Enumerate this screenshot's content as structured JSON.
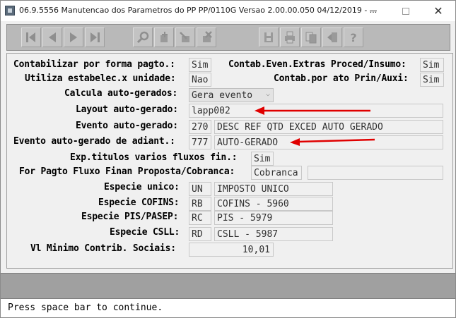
{
  "window": {
    "title": "06.9.5556 Manutencao dos  Parametros do PP PP/0110G Versao 2.00.00.050 04/12/2019 - ..."
  },
  "toolbar": {
    "buttons": [
      {
        "name": "first-record-icon"
      },
      {
        "name": "previous-record-icon"
      },
      {
        "name": "next-record-icon"
      },
      {
        "name": "last-record-icon"
      },
      {
        "name": "search-icon"
      },
      {
        "name": "add-icon"
      },
      {
        "name": "edit-icon"
      },
      {
        "name": "delete-icon"
      },
      {
        "name": "save-icon"
      },
      {
        "name": "print-icon"
      },
      {
        "name": "copy-icon"
      },
      {
        "name": "exit-icon"
      },
      {
        "name": "help-icon"
      }
    ]
  },
  "form": {
    "contabilizar_label": "Contabilizar por forma pagto.:",
    "contabilizar_value": "Sim",
    "contab_even_label": "Contab.Even.Extras Proced/Insumo:",
    "contab_even_value": "Sim",
    "utiliza_label": "Utiliza estabelec.x unidade:",
    "utiliza_value": "Nao",
    "contab_ato_label": "Contab.por ato Prin/Auxi:",
    "contab_ato_value": "Sim",
    "calcula_label": "Calcula auto-gerados:",
    "calcula_value": "Gera evento",
    "layout_label": "Layout auto-gerado:",
    "layout_value": "lapp002",
    "evento_label": "Evento auto-gerado:",
    "evento_code": "270",
    "evento_desc": "DESC REF QTD EXCED AUTO GERADO",
    "adiant_label": "Evento auto-gerado de adiant.:",
    "adiant_code": "777",
    "adiant_desc": "AUTO-GERADO",
    "exp_label": "Exp.titulos varios fluxos fin.:",
    "exp_value": "Sim",
    "for_pagto_label": "For Pagto Fluxo Finan Proposta/Cobranca:",
    "for_pagto_value": "Cobranca",
    "for_pagto_extra": "",
    "especie_unico_label": "Especie unico:",
    "especie_unico_code": "UN",
    "especie_unico_desc": "IMPOSTO UNICO",
    "cofins_label": "Especie COFINS:",
    "cofins_code": "RB",
    "cofins_desc": "COFINS - 5960",
    "pis_label": "Especie PIS/PASEP:",
    "pis_code": "RC",
    "pis_desc": "PIS - 5979",
    "csll_label": "Especie CSLL:",
    "csll_code": "RD",
    "csll_desc": "CSLL - 5987",
    "vl_minimo_label": "Vl Minimo Contrib. Sociais:",
    "vl_minimo_value": "10,01"
  },
  "status": {
    "message": "Press space bar to continue."
  },
  "colors": {
    "arrow": "#e00000",
    "toolbar_bg": "#b9b9b9",
    "band": "#a0a0a0"
  }
}
